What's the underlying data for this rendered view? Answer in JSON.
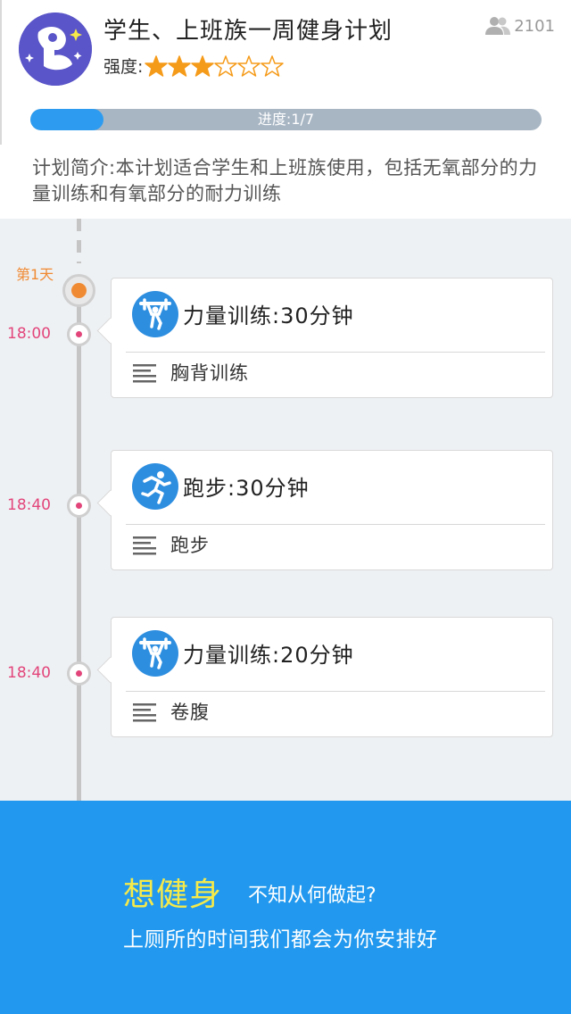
{
  "plan": {
    "title": "学生、上班族一周健身计划",
    "participants": "2101",
    "intensity_label": "强度:",
    "intensity_stars_filled": 3,
    "intensity_stars_total": 6,
    "progress_text": "进度:1/7",
    "progress_fraction": 0.142857,
    "intro": "计划简介:本计划适合学生和上班族使用，包括无氧部分的力量训练和有氧部分的耐力训练"
  },
  "timeline": {
    "day_label": "第1天",
    "items": [
      {
        "time": "18:00",
        "icon": "weightlifting-icon",
        "title": "力量训练:30分钟",
        "subtitle": "胸背训练"
      },
      {
        "time": "18:40",
        "icon": "running-icon",
        "title": "跑步:30分钟",
        "subtitle": "跑步"
      },
      {
        "time": "18:40",
        "icon": "weightlifting-icon",
        "title": "力量训练:20分钟",
        "subtitle": "卷腹"
      }
    ]
  },
  "banner": {
    "headline": "想健身",
    "subhead": "不知从何做起?",
    "line2": "上厕所的时间我们都会为你安排好"
  },
  "colors": {
    "accent_blue": "#2d9cf0",
    "banner_blue": "#2299ee",
    "star_orange": "#f59b1a",
    "day_orange": "#f08a32",
    "time_pink": "#e2457a",
    "headline_yellow": "#f6ea4a",
    "avatar_purple": "#5a55c8"
  }
}
